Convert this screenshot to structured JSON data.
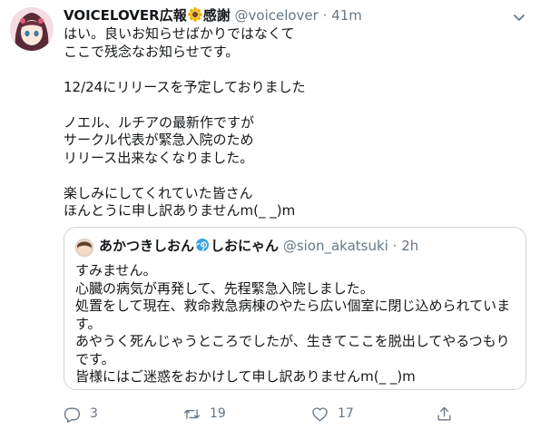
{
  "tweet": {
    "display_name": "VOICELOVER広報",
    "display_name_suffix": "感謝",
    "handle": "@voicelover",
    "separator": "·",
    "time": "41m",
    "lines": [
      "はい。良いお知らせばかりではなくて",
      "ここで残念なお知らせです。",
      "",
      "12/24にリリースを予定しておりました",
      "",
      "ノエル、ルチアの最新作ですが",
      "サークル代表が緊急入院のため",
      "リリース出来なくなりました。",
      "",
      "楽しみにしてくれていた皆さん",
      "ほんとうに申し訳ありませんm(_ _)m"
    ]
  },
  "quote": {
    "display_name": "あかつきしおん",
    "display_name_suffix": "しおにゃん",
    "handle": "@sion_akatsuki",
    "separator": "·",
    "time": "2h",
    "lines": [
      "すみません。",
      "心臓の病気が再発して、先程緊急入院しました。",
      "処置をして現在、救命救急病棟のやたら広い個室に閉じ込められていま",
      "す。",
      "あやうく死んじゃうところでしたが、生きてここを脱出してやるつもり",
      "です。",
      "皆様にはご迷惑をおかけして申し訳ありませんm(_ _)m"
    ]
  },
  "actions": {
    "reply_count": "3",
    "retweet_count": "19",
    "like_count": "17"
  },
  "colors": {
    "text": "#14171a",
    "muted": "#657786",
    "border": "#ccd6dd"
  },
  "icons": [
    "avatar",
    "sunflower-icon",
    "chevron-down-icon",
    "spiral-icon",
    "reply-icon",
    "retweet-icon",
    "like-icon",
    "share-icon"
  ]
}
